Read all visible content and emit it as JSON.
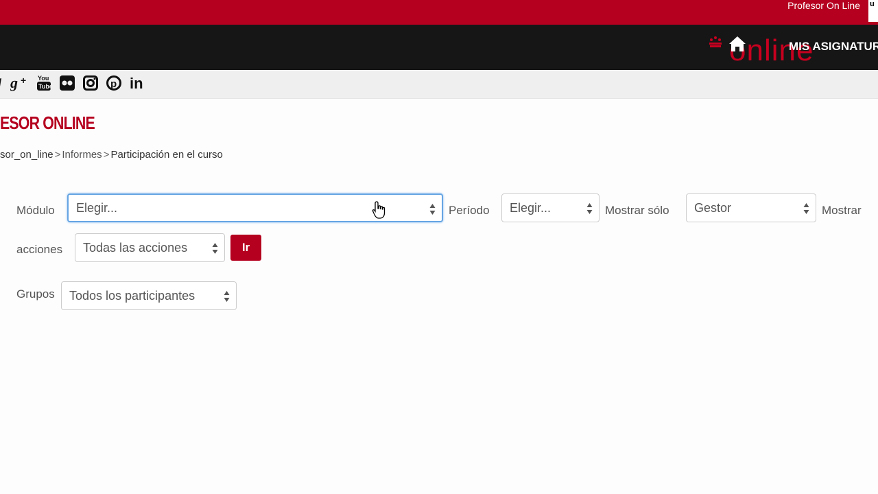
{
  "topbar": {
    "user_name": "Profesor On Line",
    "avatar_letter": "u"
  },
  "navbar": {
    "logo_text": "online",
    "nav_link": "MIS ASIGNATUR"
  },
  "social_icons": [
    "twitter-icon",
    "google-plus-icon",
    "youtube-icon",
    "flickr-icon",
    "instagram-icon",
    "pinterest-icon",
    "linkedin-icon"
  ],
  "page": {
    "title": "ESOR ONLINE"
  },
  "breadcrumb": {
    "course": "sor_on_line",
    "reports": "Informes",
    "current": "Participación en el curso",
    "separator": ">"
  },
  "filters": {
    "module_label": "Módulo",
    "module_value": "Elegir...",
    "period_label": "Período",
    "period_value": "Elegir...",
    "show_only_label": "Mostrar sólo",
    "show_only_value": "Gestor",
    "show_label": "Mostrar",
    "actions_label": "acciones",
    "actions_value": "Todas las acciones",
    "go_label": "Ir",
    "groups_label": "Grupos",
    "groups_value": "Todos los participantes"
  },
  "colors": {
    "brand_red": "#b5001f",
    "navbar": "#161616",
    "focus_blue": "#66a5e3"
  }
}
